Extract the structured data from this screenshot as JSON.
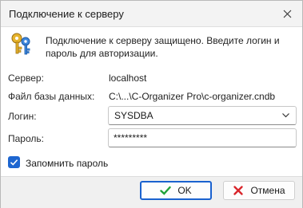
{
  "window": {
    "title": "Подключение к серверу"
  },
  "header": {
    "message": "Подключение к серверу защищено. Введите логин и пароль для авторизации."
  },
  "fields": {
    "server_label": "Сервер:",
    "server_value": "localhost",
    "dbfile_label": "Файл базы данных:",
    "dbfile_value": "C:\\...\\C-Organizer Pro\\c-organizer.cndb",
    "login_label": "Логин:",
    "login_value": "SYSDBA",
    "password_label": "Пароль:",
    "password_value": "*********"
  },
  "remember": {
    "label": "Запомнить пароль",
    "checked": true
  },
  "buttons": {
    "ok": "OK",
    "cancel": "Отмена"
  },
  "colors": {
    "accent": "#1a62cf",
    "ok_check": "#22a33a",
    "cancel_x": "#d9262c"
  },
  "icons": {
    "header": "keys-icon",
    "close": "close-icon",
    "dropdown": "chevron-down-icon"
  }
}
